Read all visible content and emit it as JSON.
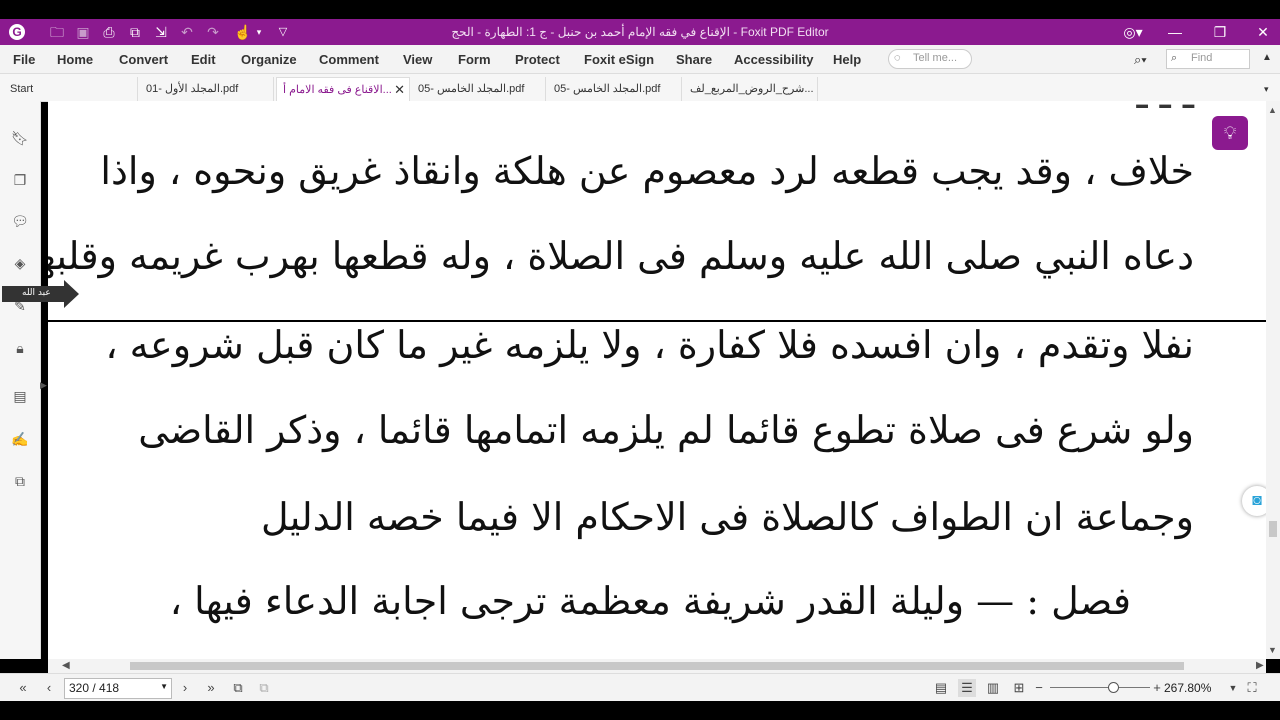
{
  "title_bar": {
    "title": "الإقناع في فقه الإمام أحمد بن حنبل - ج 1: الطهارة - الحج - Foxit PDF Editor",
    "logo": "G",
    "quick_access": [
      "open-icon",
      "save-icon",
      "print-icon",
      "new-icon",
      "undo-icon",
      "redo-icon",
      "hand-tool-icon",
      "customize-icon"
    ]
  },
  "menu": {
    "items": [
      "File",
      "Home",
      "Convert",
      "Edit",
      "Organize",
      "Comment",
      "View",
      "Form",
      "Protect",
      "Foxit eSign",
      "Share",
      "Accessibility",
      "Help"
    ],
    "tell_me_placeholder": "Tell me...",
    "find_placeholder": "Find"
  },
  "tabs": [
    {
      "label": "Start"
    },
    {
      "label": "المجلد الأول -01.pdf"
    },
    {
      "label": "الاقناع فى فقه الامام أ...",
      "active": true
    },
    {
      "label": "المجلد الخامس -05.pdf"
    },
    {
      "label": "المجلد الخامس -05.pdf"
    },
    {
      "label": "شرح_الروض_المربع_لف..."
    }
  ],
  "document": {
    "lines": [
      "خلاف ، وقد يجب قطعه لرد معصوم عن هلكة وانقاذ غريق ونحوه ، واذا",
      "دعاه النبي صلى الله عليه وسلم فى الصلاة ، وله قطعها بهرب غريمه وقلبها",
      "نفلا وتقدم ، وان افسده فلا كفارة ، ولا يلزمه غير ما كان قبل شروعه ،",
      "ولو شرع فى صلاة تطوع قائما لم يلزمه اتمامها قائما ، وذكر القاضى",
      "وجماعة ان الطواف كالصلاة فى الاحكام الا فيما خصه الدليل",
      "فصل : — وليلة القدر شريفة معظمة ترجى اجابة الدعاء فيها ،"
    ]
  },
  "tooltip": {
    "label": "عبد الله"
  },
  "status": {
    "page": "320 / 418",
    "zoom": "267.80%"
  }
}
